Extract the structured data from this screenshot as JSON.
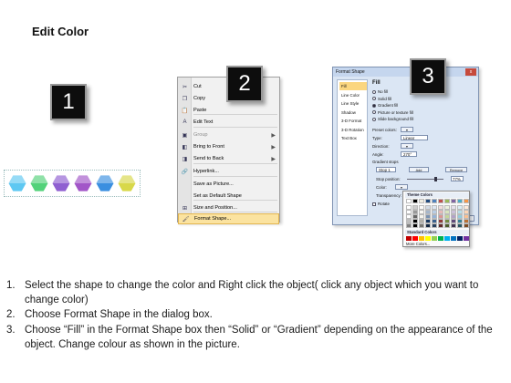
{
  "title": "Edit Color",
  "badges": [
    "1",
    "2",
    "3"
  ],
  "shape_colors": [
    "#5ec8f2",
    "#53d27a",
    "#8f5fd1",
    "#a256c8",
    "#3a8fe0",
    "#d8d84a"
  ],
  "context_menu": {
    "items": [
      {
        "icon": "cut-icon",
        "glyph": "✂",
        "label": "Cut",
        "submenu": false,
        "disabled": false
      },
      {
        "icon": "copy-icon",
        "glyph": "❐",
        "label": "Copy",
        "submenu": false,
        "disabled": false
      },
      {
        "icon": "paste-icon",
        "glyph": "📋",
        "label": "Paste",
        "submenu": false,
        "disabled": false
      },
      {
        "icon": "edit-text-icon",
        "glyph": "A",
        "label": "Edit Text",
        "submenu": false,
        "disabled": false
      },
      {
        "icon": "group-icon",
        "glyph": "▣",
        "label": "Group",
        "submenu": true,
        "disabled": true
      },
      {
        "icon": "bring-to-front-icon",
        "glyph": "◧",
        "label": "Bring to Front",
        "submenu": true,
        "disabled": false
      },
      {
        "icon": "send-to-back-icon",
        "glyph": "◨",
        "label": "Send to Back",
        "submenu": true,
        "disabled": false
      },
      {
        "icon": "hyperlink-icon",
        "glyph": "🔗",
        "label": "Hyperlink...",
        "submenu": false,
        "disabled": false
      },
      {
        "icon": "save-as-picture-icon",
        "glyph": "",
        "label": "Save as Picture...",
        "submenu": false,
        "disabled": false
      },
      {
        "icon": "default-shape-icon",
        "glyph": "",
        "label": "Set as Default Shape",
        "submenu": false,
        "disabled": false
      },
      {
        "icon": "size-position-icon",
        "glyph": "⊞",
        "label": "Size and Position...",
        "submenu": false,
        "disabled": false
      },
      {
        "icon": "format-shape-icon",
        "glyph": "🖌",
        "label": "Format Shape...",
        "submenu": false,
        "disabled": false
      }
    ]
  },
  "format_dialog": {
    "title": "Format Shape",
    "close": "x",
    "nav": [
      "Fill",
      "Line Color",
      "Line Style",
      "Shadow",
      "3-D Format",
      "3-D Rotation",
      "Text Box"
    ],
    "fill_heading": "Fill",
    "fill_options": [
      {
        "label": "No fill",
        "selected": false
      },
      {
        "label": "Solid fill",
        "selected": false
      },
      {
        "label": "Gradient fill",
        "selected": true
      },
      {
        "label": "Picture or texture fill",
        "selected": false
      },
      {
        "label": "Slide background fill",
        "selected": false
      }
    ],
    "preset_colors_label": "Preset colors:",
    "type_label": "Type:",
    "type_value": "Linear",
    "direction_label": "Direction:",
    "angle_label": "Angle:",
    "angle_value": "270°",
    "gradient_stops_label": "Gradient stops",
    "stop_value": "Stop 1",
    "add_label": "Add",
    "remove_label": "Remove",
    "stop_position_label": "Stop position:",
    "stop_position_value": "77%",
    "color_label": "Color:",
    "transparency_label": "Transparency:",
    "rotate_label": "Rotate",
    "close_button": "Close"
  },
  "color_popup": {
    "theme_heading": "Theme Colors",
    "standard_heading": "Standard Colors",
    "more_colors": "More Colors...",
    "theme_top": [
      "#ffffff",
      "#000000",
      "#eeece1",
      "#1f497d",
      "#4f81bd",
      "#c0504d",
      "#9bbb59",
      "#8064a2",
      "#4bacc6",
      "#f79646"
    ],
    "standard": [
      "#c00000",
      "#ff0000",
      "#ffc000",
      "#ffff00",
      "#92d050",
      "#00b050",
      "#00b0f0",
      "#0070c0",
      "#002060",
      "#7030a0"
    ]
  },
  "instructions": [
    {
      "num": "1.",
      "text": "Select the shape to change the color and Right click the object( click any object which you want to change color)"
    },
    {
      "num": "2.",
      "text": "Choose Format Shape in the dialog box."
    },
    {
      "num": "3.",
      "text": "Choose “Fill” in the Format Shape box then “Solid” or “Gradient” depending on the appearance of the object. Change colour as shown in the picture."
    }
  ]
}
